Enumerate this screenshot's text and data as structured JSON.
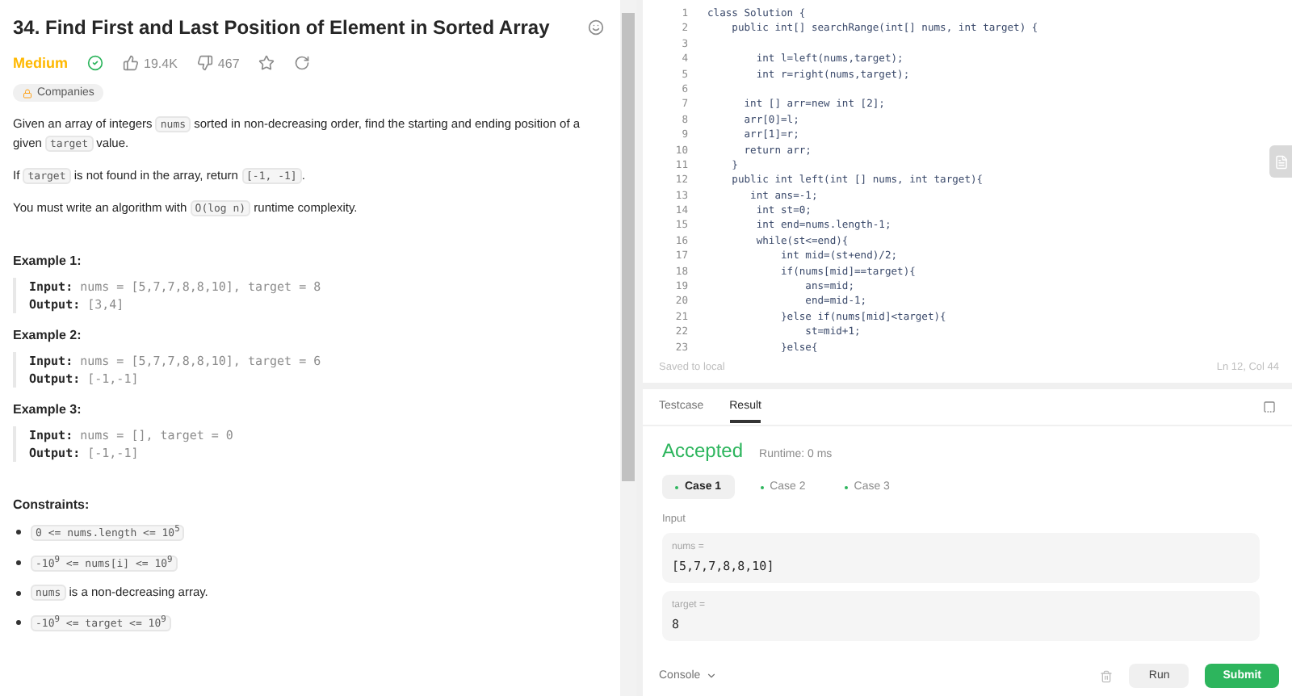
{
  "problem": {
    "title": "34. Find First and Last Position of Element in Sorted Array",
    "difficulty": "Medium",
    "solved": true,
    "likes": "19.4K",
    "dislikes": "467",
    "companies": "Companies",
    "paragraphs": [
      [
        {
          "text": "Given an array of integers ",
          "code": false
        },
        {
          "text": "nums",
          "code": true
        },
        {
          "text": " sorted in non-decreasing order, find the starting and ending position of a given ",
          "code": false
        },
        {
          "text": "target",
          "code": true
        },
        {
          "text": " value.",
          "code": false
        }
      ],
      [
        {
          "text": "If ",
          "code": false
        },
        {
          "text": "target",
          "code": true
        },
        {
          "text": " is not found in the array, return ",
          "code": false
        },
        {
          "text": "[-1, -1]",
          "code": true
        },
        {
          "text": ".",
          "code": false
        }
      ],
      [
        {
          "text": "You must write an algorithm with ",
          "code": false
        },
        {
          "text": "O(log n)",
          "code": true
        },
        {
          "text": " runtime complexity.",
          "code": false
        }
      ]
    ],
    "examples": [
      {
        "heading": "Example 1:",
        "input_label": "Input:",
        "input": "nums = [5,7,7,8,8,10], target = 8",
        "output_label": "Output:",
        "output": "[3,4]"
      },
      {
        "heading": "Example 2:",
        "input_label": "Input:",
        "input": "nums = [5,7,7,8,8,10], target = 6",
        "output_label": "Output:",
        "output": "[-1,-1]"
      },
      {
        "heading": "Example 3:",
        "input_label": "Input:",
        "input": "nums = [], target = 0",
        "output_label": "Output:",
        "output": "[-1,-1]"
      }
    ],
    "constraints_heading": "Constraints:",
    "constraints": [
      [
        {
          "text": "0 <= nums.length <= 10$^{5}$",
          "code": true
        }
      ],
      [
        {
          "text": "-10$^{9}$ <= nums[i] <= 10$^{9}$",
          "code": true
        }
      ],
      [
        {
          "text": "nums",
          "code": true
        },
        {
          "text": " is a non-decreasing array.",
          "code": false
        }
      ],
      [
        {
          "text": "-10$^{9}$ <= target <= 10$^{9}$",
          "code": true
        }
      ]
    ]
  },
  "editor": {
    "lines": [
      {
        "number": "1",
        "code": "class Solution {"
      },
      {
        "number": "2",
        "code": "    public int[] searchRange(int[] nums, int target) {"
      },
      {
        "number": "3"
      },
      {
        "number": "4",
        "code": "        int l=left(nums,target);"
      },
      {
        "number": "5",
        "code": "        int r=right(nums,target);"
      },
      {
        "number": "6"
      },
      {
        "number": "7",
        "code": "      int [] arr=new int [2];"
      },
      {
        "number": "8",
        "code": "      arr[0]=l;"
      },
      {
        "number": "9",
        "code": "      arr[1]=r;"
      },
      {
        "number": "10",
        "code": "      return arr;"
      },
      {
        "number": "11",
        "code": "    }"
      },
      {
        "number": "12",
        "code": "    public int left(int [] nums, int target){"
      },
      {
        "number": "13",
        "code": "       int ans=-1;"
      },
      {
        "number": "14",
        "code": "        int st=0;"
      },
      {
        "number": "15",
        "code": "        int end=nums.length-1;"
      },
      {
        "number": "16",
        "code": "        while(st<=end){"
      },
      {
        "number": "17",
        "code": "            int mid=(st+end)/2;"
      },
      {
        "number": "18",
        "code": "            if(nums[mid]==target){"
      },
      {
        "number": "19",
        "code": "                ans=mid;"
      },
      {
        "number": "20",
        "code": "                end=mid-1;"
      },
      {
        "number": "21",
        "code": "            }else if(nums[mid]<target){"
      },
      {
        "number": "22",
        "code": "                st=mid+1;"
      },
      {
        "number": "23",
        "code": "            }else{"
      }
    ],
    "saved": "Saved to local",
    "position": "Ln 12, Col 44"
  },
  "result": {
    "tabs": [
      {
        "label": "Testcase",
        "selected": false
      },
      {
        "label": "Result",
        "selected": true
      }
    ],
    "status": "Accepted",
    "runtime": "Runtime: 0 ms",
    "cases": [
      {
        "label": "Case 1",
        "selected": true
      },
      {
        "label": "Case 2",
        "selected": false
      },
      {
        "label": "Case 3",
        "selected": false
      }
    ],
    "input_heading": "Input",
    "inputs": [
      {
        "name": "nums =",
        "value": "[5,7,7,8,8,10]"
      },
      {
        "name": "target =",
        "value": "8"
      }
    ],
    "console": "Console",
    "run": "Run",
    "submit": "Submit"
  }
}
